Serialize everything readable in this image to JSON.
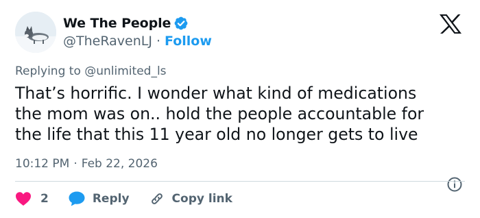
{
  "author": {
    "display_name": "We The People",
    "handle": "@TheRavenLJ",
    "separator": "·",
    "follow_label": "Follow"
  },
  "reply_context": "Replying to @unlimited_ls",
  "tweet": {
    "lines": [
      "That’s horrific. I wonder what kind of medications",
      "the mom was on.. hold the people accountable for",
      "the life that this 11 year old no longer gets to live"
    ]
  },
  "meta": {
    "time": "10:12 PM",
    "separator": "·",
    "date": "Feb 22, 2026"
  },
  "actions": {
    "like_count": "2",
    "reply_label": "Reply",
    "copy_link_label": "Copy link"
  },
  "colors": {
    "text": "#0f1419",
    "muted": "#536471",
    "accent": "#1d9bf0",
    "like": "#f91880",
    "divider": "#cfd9de"
  },
  "icons": [
    "avatar-husky",
    "verified-badge-icon",
    "x-logo-icon",
    "info-icon",
    "heart-icon",
    "reply-bubble-icon",
    "link-icon"
  ]
}
